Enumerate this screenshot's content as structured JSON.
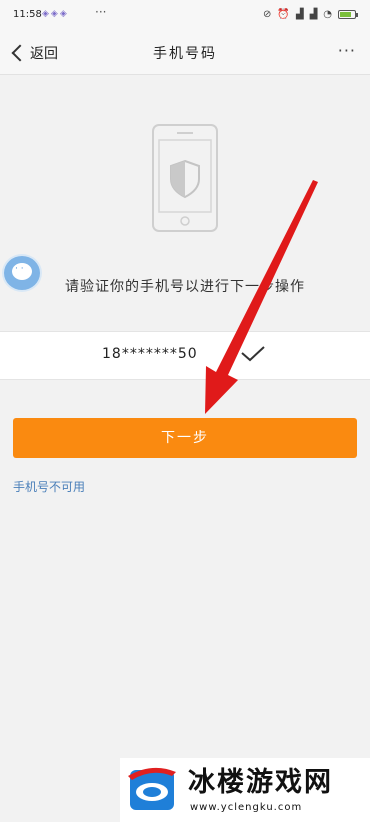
{
  "status_bar": {
    "time": "11:58",
    "left_icons": [
      "notification-icon",
      "notification-icon",
      "notification-icon"
    ],
    "left_dots": "···",
    "right_icons": [
      "mute-icon",
      "alarm-icon",
      "hd-signal-icon",
      "hd-signal-icon",
      "wifi-icon"
    ],
    "battery_level": 0.7
  },
  "nav": {
    "back_label": "返回",
    "title": "手机号码",
    "more_label": "···"
  },
  "main": {
    "verify_text": "请验证你的手机号以进行下一步操作",
    "phone_number": "18*******50",
    "next_button": "下一步",
    "unavailable_link": "手机号不可用"
  },
  "watermark": {
    "title": "冰楼游戏网",
    "url": "www.yclengku.com"
  },
  "colors": {
    "accent": "#fa8a10",
    "link": "#4a7fb9",
    "annotation_arrow": "#e01a1a"
  }
}
